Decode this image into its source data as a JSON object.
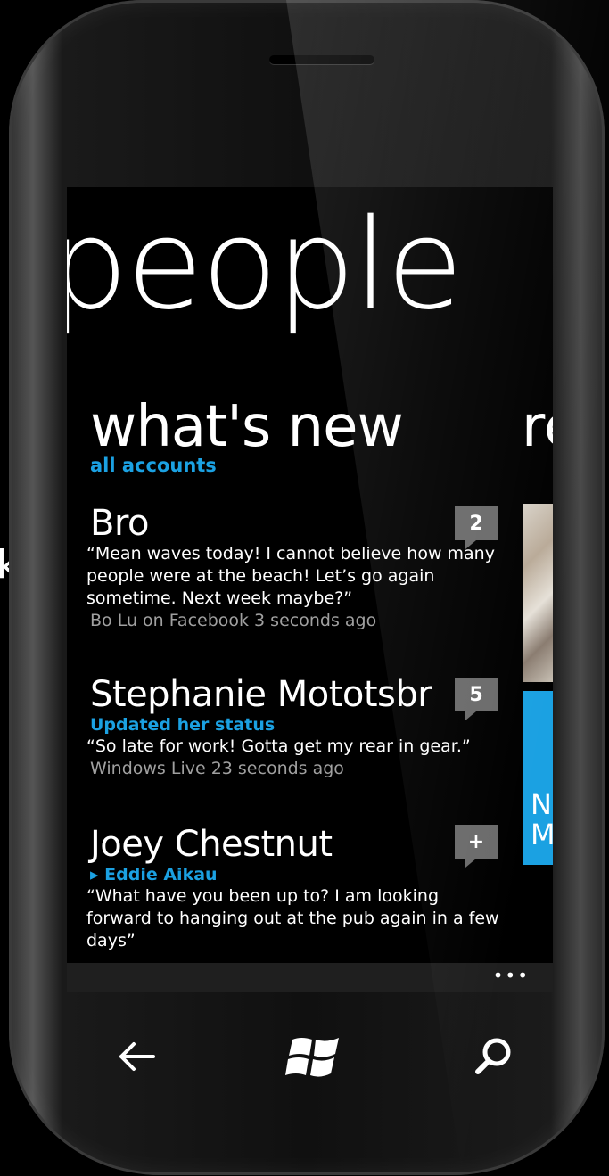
{
  "panorama": {
    "title": "people"
  },
  "pivot": {
    "header": "what's new",
    "next_header": "re",
    "filter": "all accounts"
  },
  "side_letter": "k",
  "feed": [
    {
      "name": "Bro",
      "badge": "2",
      "subtitle": "",
      "quote": "“Mean waves today! I cannot believe how many people were at the beach! Let’s go again sometime. Next week maybe?”",
      "meta": "Bo Lu on Facebook 3 seconds ago"
    },
    {
      "name": "Stephanie Mototsbr",
      "badge": "5",
      "subtitle": "Updated her status",
      "quote": "“So late for work! Gotta get my rear in gear.”",
      "meta": "Windows Live 23 seconds ago"
    },
    {
      "name": "Joey Chestnut",
      "badge": "+",
      "subtitle": "▸ Eddie Aikau",
      "quote": "“What have you been up to? I am looking forward to hanging out at the pub again in a few days”",
      "meta": ""
    }
  ],
  "tile_text": "N\nM",
  "appbar": {
    "more": "•••"
  },
  "hardware_buttons": [
    "back-arrow-icon",
    "windows-logo-icon",
    "search-icon"
  ],
  "colors": {
    "accent": "#1ba1e2",
    "badge": "#6b6b6b",
    "background": "#000000"
  }
}
